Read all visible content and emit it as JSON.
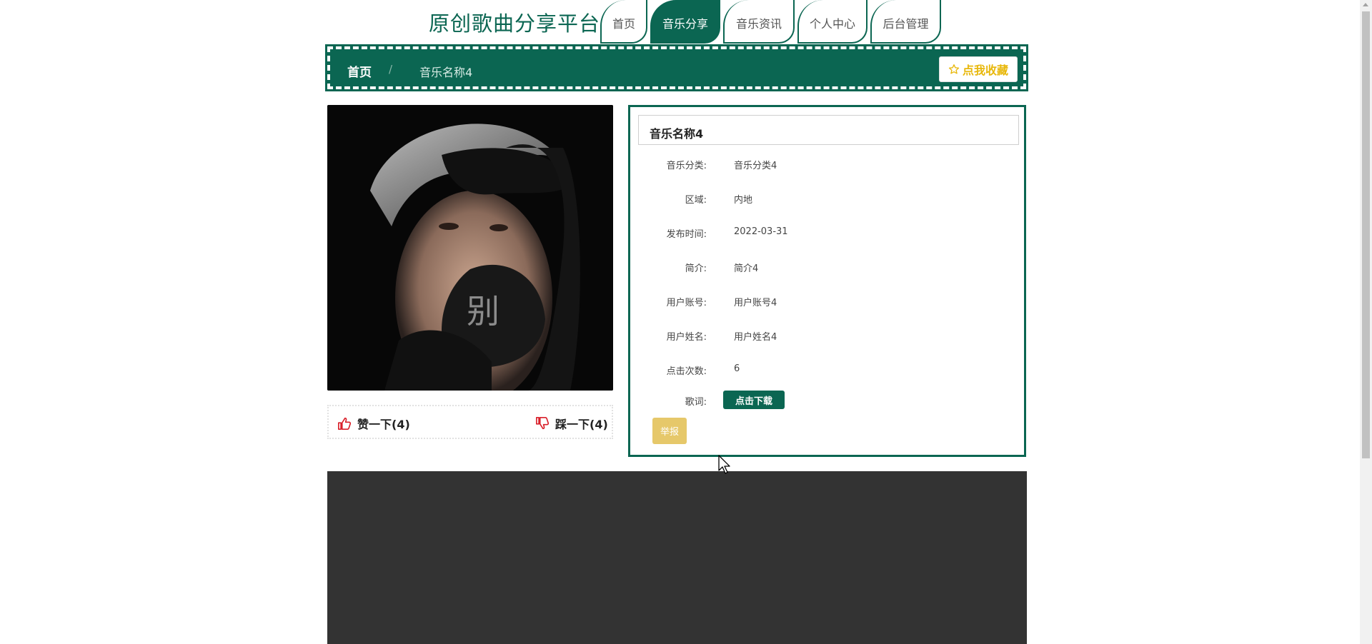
{
  "header": {
    "site_title": "原创歌曲分享平台",
    "nav": [
      {
        "label": "首页",
        "active": false
      },
      {
        "label": "音乐分享",
        "active": true
      },
      {
        "label": "音乐资讯",
        "active": false
      },
      {
        "label": "个人中心",
        "active": false
      },
      {
        "label": "后台管理",
        "active": false
      }
    ]
  },
  "breadcrumb": {
    "home": "首页",
    "separator": "/",
    "current": "音乐名称4",
    "favorite_label": "点我收藏",
    "favorite_icon": "star-outline-icon"
  },
  "cover": {
    "character": "别"
  },
  "votes": {
    "like_label": "赞一下(4)",
    "dislike_label": "踩一下(4)"
  },
  "detail": {
    "title": "音乐名称4",
    "fields": [
      {
        "label": "音乐分类:",
        "value": "音乐分类4"
      },
      {
        "label": "区域:",
        "value": "内地"
      },
      {
        "label": "发布时间:",
        "value": "2022-03-31"
      },
      {
        "label": "简介:",
        "value": "简介4"
      },
      {
        "label": "用户账号:",
        "value": "用户账号4"
      },
      {
        "label": "用户姓名:",
        "value": "用户姓名4"
      },
      {
        "label": "点击次数:",
        "value": "6"
      }
    ],
    "lyrics_label": "歌词:",
    "download_label": "点击下载",
    "report_label": "举报"
  },
  "colors": {
    "primary": "#0b6652",
    "gold": "#e8b80c",
    "report": "#e6c86a",
    "footer": "#333333"
  }
}
